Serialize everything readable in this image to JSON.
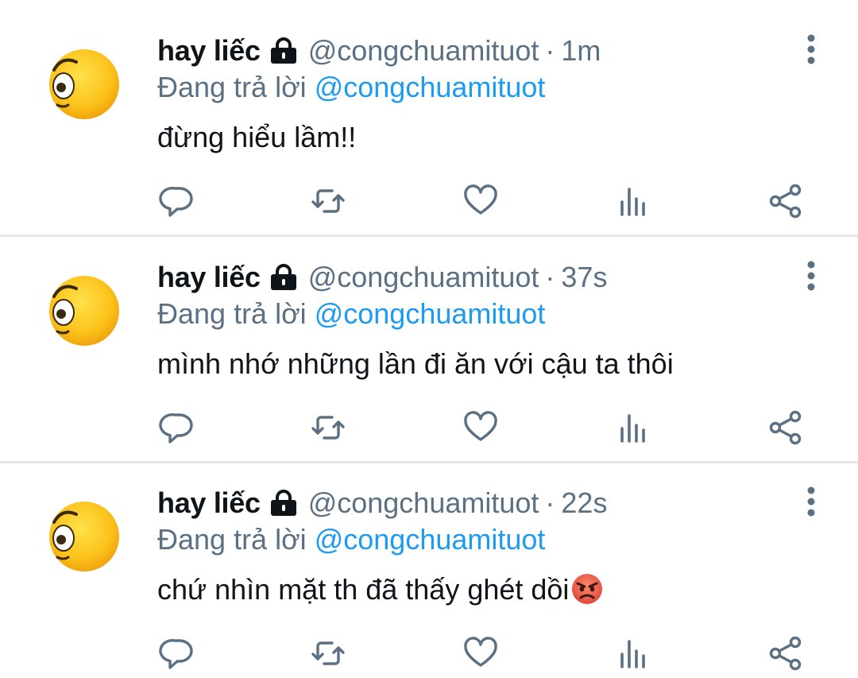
{
  "colors": {
    "name": "#0f1419",
    "secondary": "#5b7083",
    "mention": "#1d9bf0",
    "divider": "#e3e7ea"
  },
  "tweets": [
    {
      "display_name": "hay liếc",
      "handle": "@congchuamituot",
      "separator": "·",
      "time": "1m",
      "reply_prefix": "Đang trả lời",
      "reply_to": "@congchuamituot",
      "text": "đừng hiểu lầm!!",
      "emoji": ""
    },
    {
      "display_name": "hay liếc",
      "handle": "@congchuamituot",
      "separator": "·",
      "time": "37s",
      "reply_prefix": "Đang trả lời",
      "reply_to": "@congchuamituot",
      "text": "mình nhớ những lần đi ăn với cậu ta thôi",
      "emoji": ""
    },
    {
      "display_name": "hay liếc",
      "handle": "@congchuamituot",
      "separator": "·",
      "time": "22s",
      "reply_prefix": "Đang trả lời",
      "reply_to": "@congchuamituot",
      "text": "chứ nhìn mặt th đã thấy ghét dồi",
      "emoji": "angry-face"
    }
  ],
  "icons": {
    "avatar": "side-eye-emoji-face",
    "lock": "lock-icon",
    "more": "more-vertical-icon",
    "reply": "reply-icon",
    "retweet": "retweet-icon",
    "like": "heart-icon",
    "analytics": "analytics-icon",
    "share": "share-icon"
  }
}
